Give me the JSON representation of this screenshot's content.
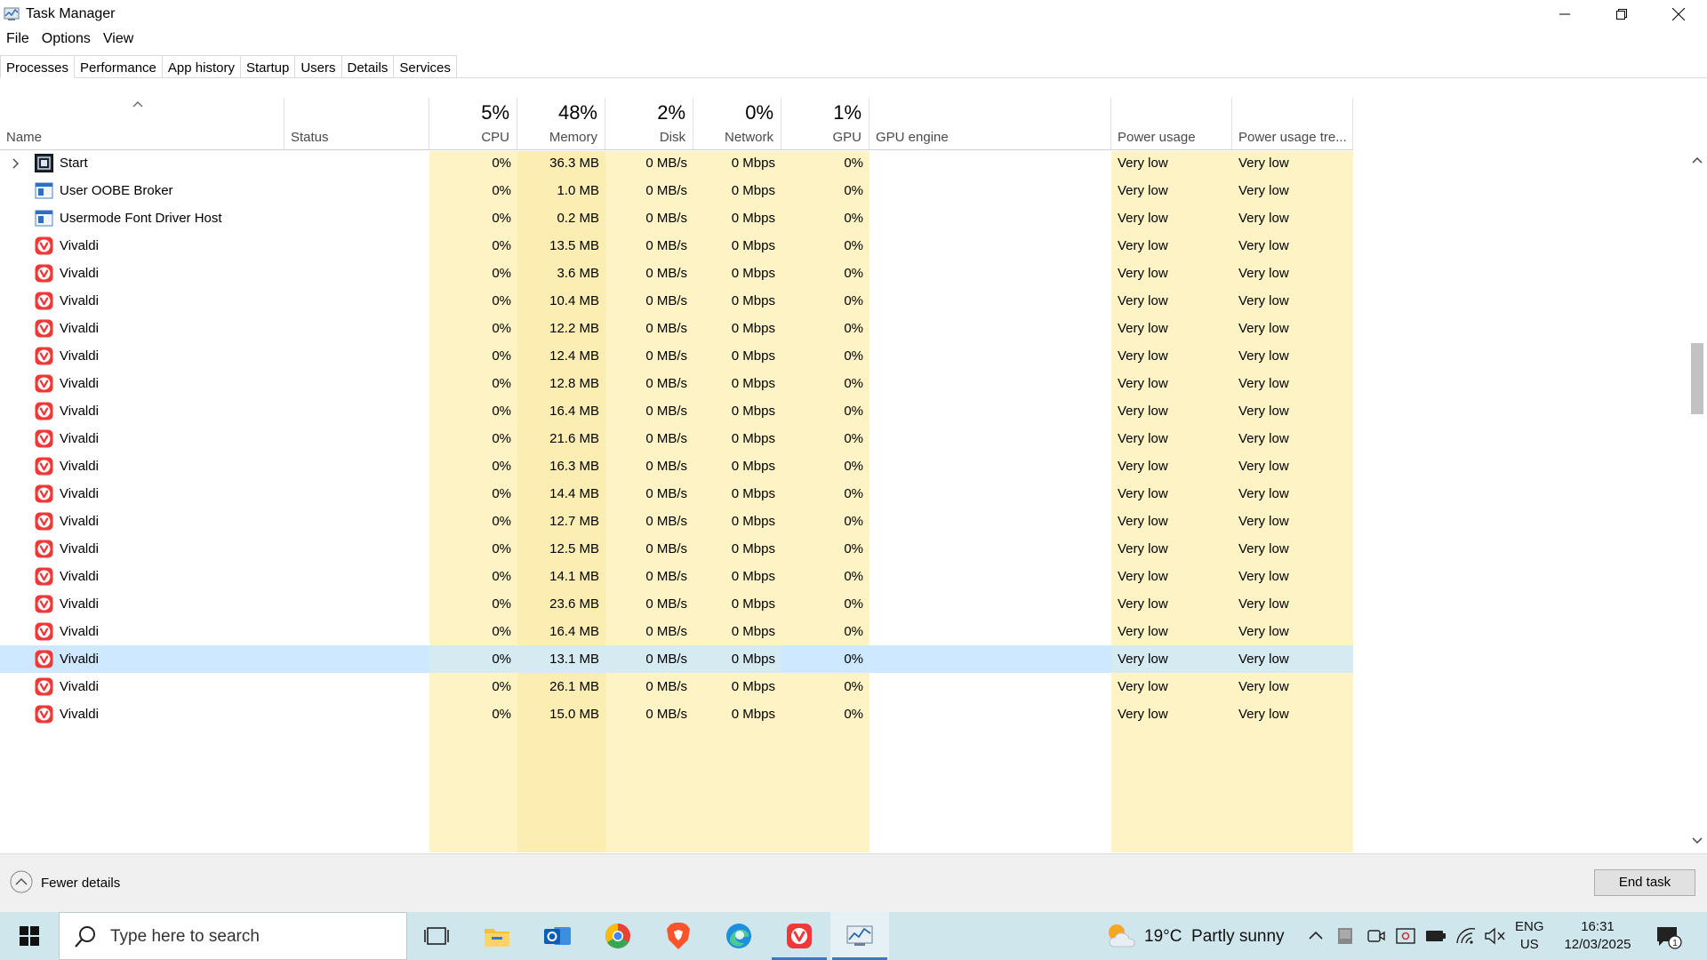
{
  "window": {
    "title": "Task Manager"
  },
  "menu": [
    "File",
    "Options",
    "View"
  ],
  "tabs": [
    {
      "label": "Processes",
      "active": true
    },
    {
      "label": "Performance",
      "active": false
    },
    {
      "label": "App history",
      "active": false
    },
    {
      "label": "Startup",
      "active": false
    },
    {
      "label": "Users",
      "active": false
    },
    {
      "label": "Details",
      "active": false
    },
    {
      "label": "Services",
      "active": false
    }
  ],
  "columns": {
    "name": {
      "label": "Name"
    },
    "status": {
      "label": "Status"
    },
    "cpu": {
      "label": "CPU",
      "total": "5%"
    },
    "memory": {
      "label": "Memory",
      "total": "48%"
    },
    "disk": {
      "label": "Disk",
      "total": "2%"
    },
    "network": {
      "label": "Network",
      "total": "0%"
    },
    "gpu": {
      "label": "GPU",
      "total": "1%"
    },
    "gpu_engine": {
      "label": "GPU engine"
    },
    "power": {
      "label": "Power usage"
    },
    "power_trend": {
      "label": "Power usage tre..."
    }
  },
  "processes": [
    {
      "name": "Start",
      "icon": "start-app-icon",
      "expandable": true,
      "cpu": "0%",
      "memory": "36.3 MB",
      "disk": "0 MB/s",
      "network": "0 Mbps",
      "gpu": "0%",
      "power": "Very low",
      "power_trend": "Very low"
    },
    {
      "name": "User OOBE Broker",
      "icon": "system-window-icon",
      "cpu": "0%",
      "memory": "1.0 MB",
      "disk": "0 MB/s",
      "network": "0 Mbps",
      "gpu": "0%",
      "power": "Very low",
      "power_trend": "Very low"
    },
    {
      "name": "Usermode Font Driver Host",
      "icon": "system-window-icon",
      "cpu": "0%",
      "memory": "0.2 MB",
      "disk": "0 MB/s",
      "network": "0 Mbps",
      "gpu": "0%",
      "power": "Very low",
      "power_trend": "Very low"
    },
    {
      "name": "Vivaldi",
      "icon": "vivaldi-icon",
      "cpu": "0%",
      "memory": "13.5 MB",
      "disk": "0 MB/s",
      "network": "0 Mbps",
      "gpu": "0%",
      "power": "Very low",
      "power_trend": "Very low"
    },
    {
      "name": "Vivaldi",
      "icon": "vivaldi-icon",
      "cpu": "0%",
      "memory": "3.6 MB",
      "disk": "0 MB/s",
      "network": "0 Mbps",
      "gpu": "0%",
      "power": "Very low",
      "power_trend": "Very low"
    },
    {
      "name": "Vivaldi",
      "icon": "vivaldi-icon",
      "cpu": "0%",
      "memory": "10.4 MB",
      "disk": "0 MB/s",
      "network": "0 Mbps",
      "gpu": "0%",
      "power": "Very low",
      "power_trend": "Very low"
    },
    {
      "name": "Vivaldi",
      "icon": "vivaldi-icon",
      "cpu": "0%",
      "memory": "12.2 MB",
      "disk": "0 MB/s",
      "network": "0 Mbps",
      "gpu": "0%",
      "power": "Very low",
      "power_trend": "Very low"
    },
    {
      "name": "Vivaldi",
      "icon": "vivaldi-icon",
      "cpu": "0%",
      "memory": "12.4 MB",
      "disk": "0 MB/s",
      "network": "0 Mbps",
      "gpu": "0%",
      "power": "Very low",
      "power_trend": "Very low"
    },
    {
      "name": "Vivaldi",
      "icon": "vivaldi-icon",
      "cpu": "0%",
      "memory": "12.8 MB",
      "disk": "0 MB/s",
      "network": "0 Mbps",
      "gpu": "0%",
      "power": "Very low",
      "power_trend": "Very low"
    },
    {
      "name": "Vivaldi",
      "icon": "vivaldi-icon",
      "cpu": "0%",
      "memory": "16.4 MB",
      "disk": "0 MB/s",
      "network": "0 Mbps",
      "gpu": "0%",
      "power": "Very low",
      "power_trend": "Very low"
    },
    {
      "name": "Vivaldi",
      "icon": "vivaldi-icon",
      "cpu": "0%",
      "memory": "21.6 MB",
      "disk": "0 MB/s",
      "network": "0 Mbps",
      "gpu": "0%",
      "power": "Very low",
      "power_trend": "Very low"
    },
    {
      "name": "Vivaldi",
      "icon": "vivaldi-icon",
      "cpu": "0%",
      "memory": "16.3 MB",
      "disk": "0 MB/s",
      "network": "0 Mbps",
      "gpu": "0%",
      "power": "Very low",
      "power_trend": "Very low"
    },
    {
      "name": "Vivaldi",
      "icon": "vivaldi-icon",
      "cpu": "0%",
      "memory": "14.4 MB",
      "disk": "0 MB/s",
      "network": "0 Mbps",
      "gpu": "0%",
      "power": "Very low",
      "power_trend": "Very low"
    },
    {
      "name": "Vivaldi",
      "icon": "vivaldi-icon",
      "cpu": "0%",
      "memory": "12.7 MB",
      "disk": "0 MB/s",
      "network": "0 Mbps",
      "gpu": "0%",
      "power": "Very low",
      "power_trend": "Very low"
    },
    {
      "name": "Vivaldi",
      "icon": "vivaldi-icon",
      "cpu": "0%",
      "memory": "12.5 MB",
      "disk": "0 MB/s",
      "network": "0 Mbps",
      "gpu": "0%",
      "power": "Very low",
      "power_trend": "Very low"
    },
    {
      "name": "Vivaldi",
      "icon": "vivaldi-icon",
      "cpu": "0%",
      "memory": "14.1 MB",
      "disk": "0 MB/s",
      "network": "0 Mbps",
      "gpu": "0%",
      "power": "Very low",
      "power_trend": "Very low"
    },
    {
      "name": "Vivaldi",
      "icon": "vivaldi-icon",
      "cpu": "0%",
      "memory": "23.6 MB",
      "disk": "0 MB/s",
      "network": "0 Mbps",
      "gpu": "0%",
      "power": "Very low",
      "power_trend": "Very low"
    },
    {
      "name": "Vivaldi",
      "icon": "vivaldi-icon",
      "cpu": "0%",
      "memory": "16.4 MB",
      "disk": "0 MB/s",
      "network": "0 Mbps",
      "gpu": "0%",
      "power": "Very low",
      "power_trend": "Very low"
    },
    {
      "name": "Vivaldi",
      "icon": "vivaldi-icon",
      "selected": true,
      "cpu": "0%",
      "memory": "13.1 MB",
      "disk": "0 MB/s",
      "network": "0 Mbps",
      "gpu": "0%",
      "power": "Very low",
      "power_trend": "Very low"
    },
    {
      "name": "Vivaldi",
      "icon": "vivaldi-icon",
      "cpu": "0%",
      "memory": "26.1 MB",
      "disk": "0 MB/s",
      "network": "0 Mbps",
      "gpu": "0%",
      "power": "Very low",
      "power_trend": "Very low"
    },
    {
      "name": "Vivaldi",
      "icon": "vivaldi-icon",
      "partial": true,
      "cpu": "0%",
      "memory": "15.0 MB",
      "disk": "0 MB/s",
      "network": "0 Mbps",
      "gpu": "0%",
      "power": "Very low",
      "power_trend": "Very low"
    }
  ],
  "footer": {
    "fewer_details": "Fewer details",
    "end_task": "End task"
  },
  "taskbar": {
    "search_placeholder": "Type here to search",
    "apps": [
      "task-view-icon",
      "file-explorer-icon",
      "outlook-icon",
      "chrome-icon",
      "brave-icon",
      "edge-icon",
      "vivaldi-icon",
      "task-manager-icon"
    ],
    "weather": {
      "temp": "19°C",
      "condition": "Partly sunny"
    },
    "lang": {
      "top": "ENG",
      "bottom": "US"
    },
    "clock": {
      "time": "16:31",
      "date": "12/03/2025"
    },
    "notification_count": "1"
  },
  "colors": {
    "cpu_heat": "#fdf3c4",
    "mem_heat": "#fceeb3",
    "selected": "#cde8ff",
    "vivaldi_red": "#ef3939",
    "taskbar": "#cfe6ec"
  }
}
